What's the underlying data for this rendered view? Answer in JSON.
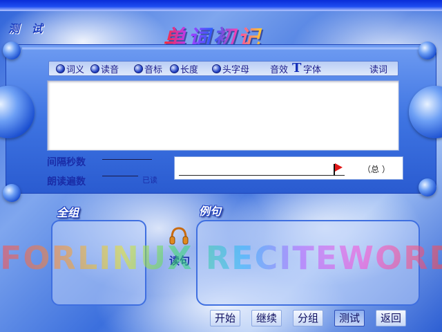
{
  "mode_title": "测 试",
  "app_title": "单词初记",
  "options": [
    {
      "label": "词义",
      "type": "radio"
    },
    {
      "label": "读音",
      "type": "radio"
    },
    {
      "label": "音标",
      "type": "radio"
    },
    {
      "label": "长度",
      "type": "radio"
    },
    {
      "label": "头字母",
      "type": "radio"
    },
    {
      "label": "音效",
      "type": "plain"
    },
    {
      "label": "字体",
      "type": "font"
    },
    {
      "label": "读词",
      "type": "plain"
    }
  ],
  "interval_label": "间隔秒数",
  "repeat_label": "朗读遍数",
  "already_read_label": "已读",
  "total_label": "（总  ）",
  "group_title": "全组",
  "example_title": "例句",
  "read_sentence_label": "读句",
  "watermark": "FORLINUX RECITEWORD",
  "buttons": [
    "开始",
    "继续",
    "分组",
    "测试",
    "返回"
  ],
  "active_button": "测试",
  "colors": {
    "accent": "#2f63d9",
    "flag": "#e01818"
  }
}
